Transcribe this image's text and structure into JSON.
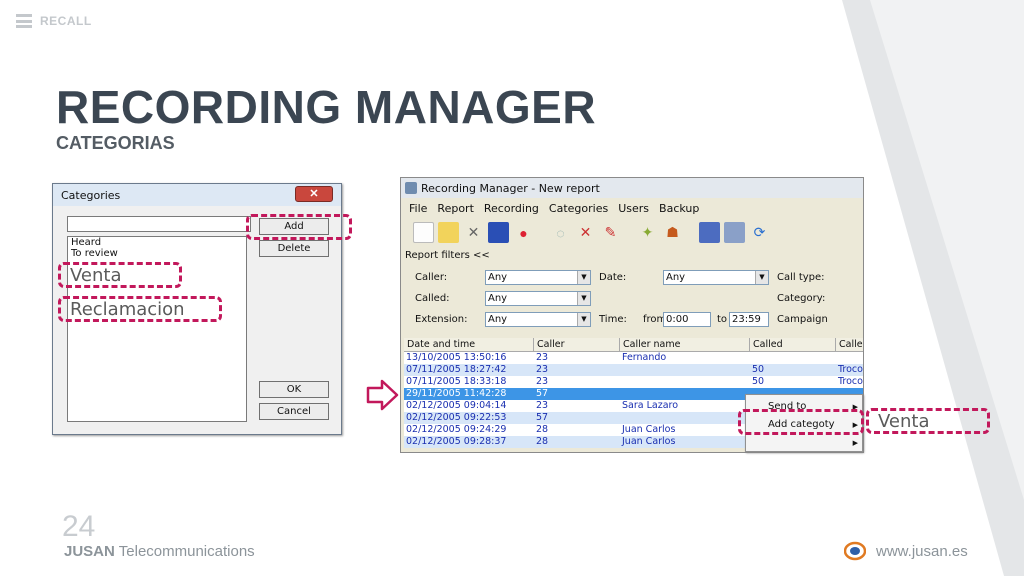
{
  "brand": {
    "label": "RECALL"
  },
  "slide": {
    "title": "RECORDING MANAGER",
    "subtitle": "CATEGORIAS",
    "page_number": "24",
    "footer_company_bold": "JUSAN",
    "footer_company_rest": "Telecommunications",
    "footer_url": "www.jusan.es"
  },
  "categories_dialog": {
    "title": "Categories",
    "close_label": "✕",
    "items": [
      "Heard",
      "To review"
    ],
    "buttons": {
      "add": "Add",
      "delete": "Delete",
      "ok": "OK",
      "cancel": "Cancel"
    },
    "annotations": {
      "venta": "Venta",
      "reclamacion": "Reclamacion"
    }
  },
  "recording_manager": {
    "title": "Recording Manager - New report",
    "menu": [
      "File",
      "Report",
      "Recording",
      "Categories",
      "Users",
      "Backup"
    ],
    "report_filters": "Report filters <<",
    "filters": {
      "caller_label": "Caller:",
      "caller_value": "Any",
      "called_label": "Called:",
      "called_value": "Any",
      "extension_label": "Extension:",
      "extension_value": "Any",
      "date_label": "Date:",
      "date_value": "Any",
      "time_label": "Time:",
      "from_label": "from",
      "from_value": "0:00",
      "to_label": "to",
      "to_value": "23:59",
      "call_type_label": "Call type:",
      "category_label": "Category:",
      "campaign_label": "Campaign"
    },
    "table": {
      "headers": [
        "Date and time",
        "Caller",
        "Caller name",
        "Called",
        "Called"
      ],
      "rows": [
        [
          "13/10/2005 13:50:16",
          "23",
          "Fernando",
          "",
          ""
        ],
        [
          "07/11/2005 18:27:42",
          "23",
          "",
          "50",
          "Trocol"
        ],
        [
          "07/11/2005 18:33:18",
          "23",
          "",
          "50",
          "Trocol"
        ],
        [
          "29/11/2005 11:42:28",
          "57",
          "",
          "",
          ""
        ],
        [
          "02/12/2005 09:04:14",
          "23",
          "Sara Lazaro",
          "",
          ""
        ],
        [
          "02/12/2005 09:22:53",
          "57",
          "",
          "",
          ""
        ],
        [
          "02/12/2005 09:24:29",
          "28",
          "Juan Carlos",
          "",
          ""
        ],
        [
          "02/12/2005 09:28:37",
          "28",
          "Juan Carlos",
          "",
          ""
        ]
      ],
      "selected_row": 3
    },
    "context_menu": {
      "send_to": "Send to",
      "add_category": "Add categoty"
    },
    "annotation": "Venta"
  }
}
